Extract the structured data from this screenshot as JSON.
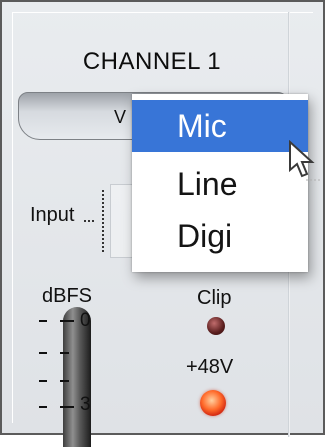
{
  "channel": {
    "title": "CHANNEL 1",
    "source_select": {
      "visible_text": "V"
    },
    "input_label": "Input",
    "meter": {
      "unit_label": "dBFS",
      "ticks": [
        {
          "label": "0"
        },
        {
          "label": ""
        },
        {
          "label": ""
        },
        {
          "label": "3"
        }
      ]
    },
    "clip": {
      "label": "Clip",
      "led_color": "#5a1e1e"
    },
    "phantom_power": {
      "label": "+48V",
      "led_color": "#ff5a1f"
    }
  },
  "dropdown": {
    "selected": "Mic",
    "items": [
      {
        "label": "Mic"
      },
      {
        "label": "Line"
      },
      {
        "label": "Digi"
      }
    ],
    "highlight_color": "#3875d7"
  },
  "icons": {
    "cursor": "arrow-pointer-icon"
  }
}
